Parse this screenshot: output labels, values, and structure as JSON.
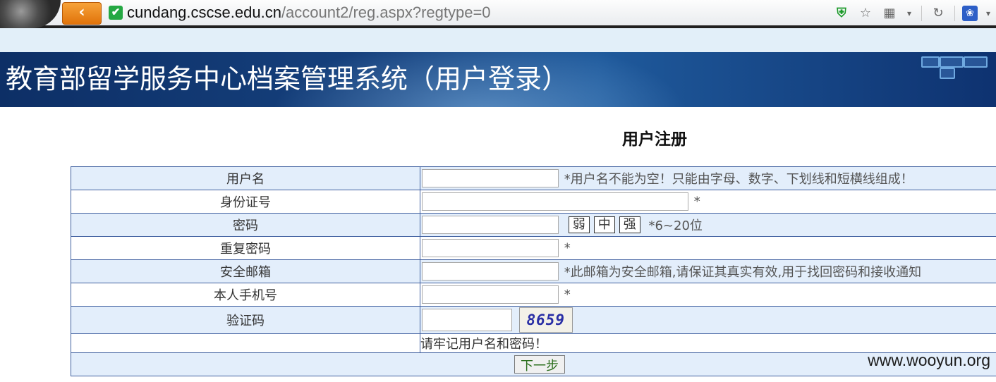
{
  "browser": {
    "url_host": "cundang.cscse.edu.cn",
    "url_path": "/account2/reg.aspx?regtype=0"
  },
  "banner": {
    "title": "教育部留学服务中心档案管理系统（用户登录）"
  },
  "form": {
    "heading": "用户注册",
    "fields": [
      {
        "label": "用户名",
        "value": "",
        "hint": "*用户名不能为空！只能由字母、数字、下划线和短横线组成！"
      },
      {
        "label": "身份证号",
        "value": "",
        "hint": "*"
      },
      {
        "label": "密码",
        "value": "",
        "hint": "*6~20位",
        "strength": [
          "弱",
          "中",
          "强"
        ]
      },
      {
        "label": "重复密码",
        "value": "",
        "hint": "*"
      },
      {
        "label": "安全邮箱",
        "value": "",
        "hint": "*此邮箱为安全邮箱,请保证其真实有效,用于找回密码和接收通知"
      },
      {
        "label": "本人手机号",
        "value": "",
        "hint": "*"
      },
      {
        "label": "验证码",
        "value": "",
        "captcha": "8659"
      }
    ],
    "remember_note": "请牢记用户名和密码！",
    "next_button": "下一步"
  },
  "watermark": "www.wooyun.org"
}
